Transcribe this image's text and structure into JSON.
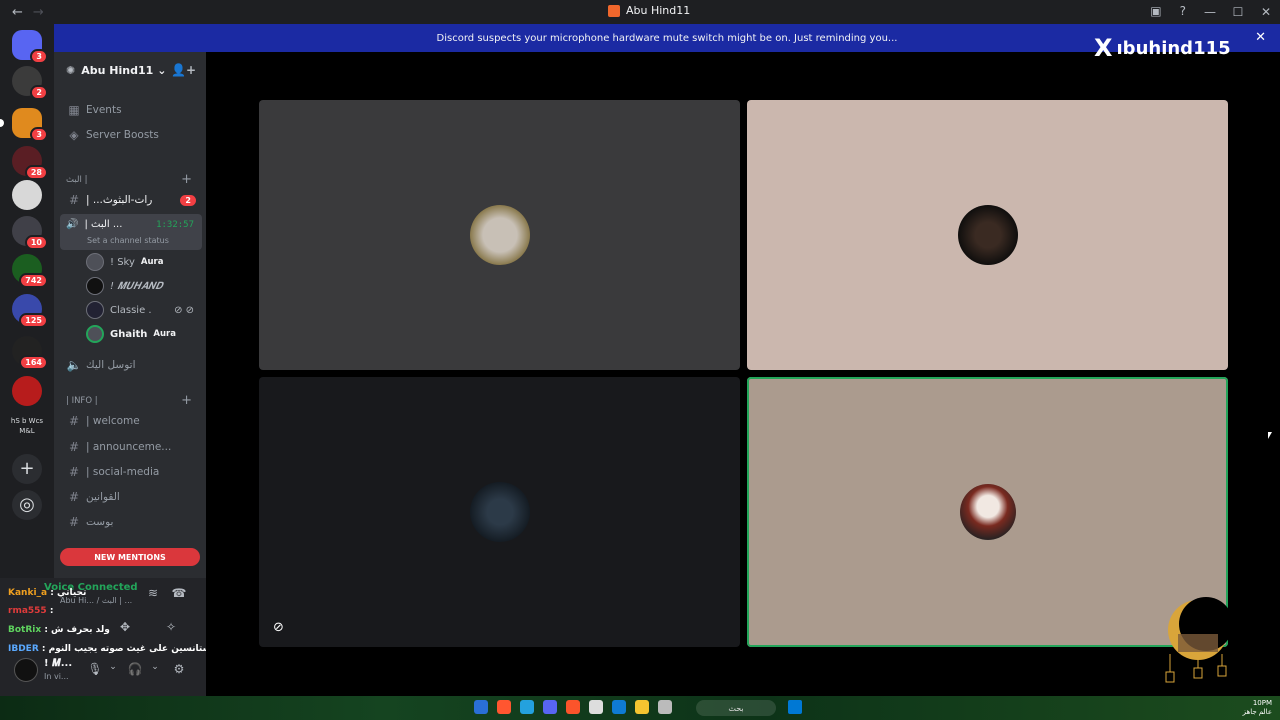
{
  "window": {
    "title": "Abu Hind11",
    "back": "←",
    "forward": "→",
    "controls": {
      "minimize": "—",
      "maximize": "☐",
      "close": "✕"
    }
  },
  "notice": {
    "text": "Discord suspects your microphone hardware mute switch might be on. Just reminding you...",
    "close": "✕"
  },
  "watermark": {
    "logo": "X",
    "handle": "ıbuhind115"
  },
  "guilds": [
    {
      "badge": "3"
    },
    {
      "badge": "2"
    },
    {
      "badge": "3"
    },
    {
      "badge": "28"
    },
    {
      "badge": ""
    },
    {
      "badge": "10"
    },
    {
      "badge": "742"
    },
    {
      "badge": "125"
    },
    {
      "badge": "164"
    },
    {
      "badge": ""
    },
    {
      "label": "hS b Wcs M&L"
    }
  ],
  "server": {
    "name": "Abu Hind11",
    "top_items": [
      {
        "label": "Events",
        "icon": "calendar-icon"
      },
      {
        "label": "Server Boosts",
        "icon": "boost-icon"
      }
    ],
    "category1": "البث |",
    "channel_text1": {
      "label": "| ...رات-البثوث",
      "badge": "2"
    },
    "voice_channel": {
      "label": "| البث ...",
      "timer": "1:32:57",
      "status": "Set a channel status"
    },
    "members": [
      {
        "name": "! Sky",
        "tag": "Aura"
      },
      {
        "name": "! 𝑴𝑼𝑯𝑨𝑵𝑫",
        "tag": ""
      },
      {
        "name": "Classie .",
        "tag": ""
      },
      {
        "name": "Ghaith",
        "tag": "Aura"
      }
    ],
    "voice_channel2": "اتوسل اليك",
    "category2": "| INFO |",
    "info_channels": [
      {
        "label": "| welcome"
      },
      {
        "label": "| announceme..."
      },
      {
        "label": "| social-media"
      },
      {
        "label": "القوانين"
      },
      {
        "label": "بوست"
      }
    ],
    "new_mentions": "NEW MENTIONS"
  },
  "voice_panel": {
    "connected": "Voice Connected",
    "sub": "Abu Hi... / البث | ...",
    "chat": [
      {
        "user": "Kanki_a",
        "text": ": تحياتي",
        "color": "#f0a020"
      },
      {
        "user": "rma555",
        "text": ":",
        "color": "#e03b3b"
      },
      {
        "user": "BotRix",
        "text": ": ولد بحرف ش",
        "color": "#5fd35f"
      },
      {
        "user": "IBDER",
        "text": ": مستانسين على غيث صوته يجيب النوم",
        "color": "#5aa9ff"
      }
    ],
    "user_name": "! 𝑴...",
    "user_status": "In vi..."
  },
  "tiles": [
    {
      "bg": "#3a3a3c"
    },
    {
      "bg": "#cbb7ae"
    },
    {
      "bg": "#18191c"
    },
    {
      "bg": "#ab9b8e"
    }
  ],
  "taskbar": {
    "search": "بحث",
    "time": "10PM",
    "date": "عالم جاهز"
  }
}
